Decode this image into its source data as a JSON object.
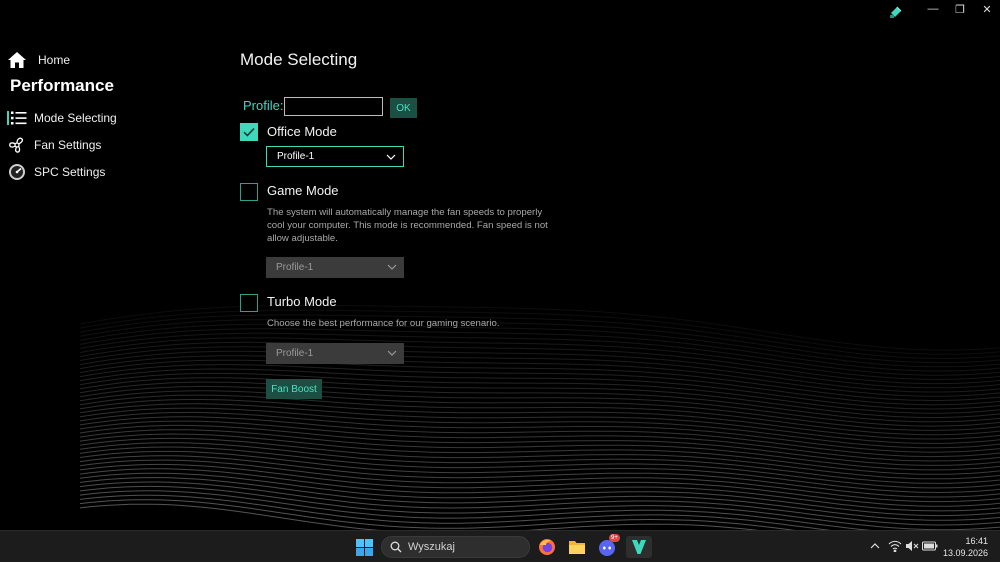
{
  "window": {
    "controls": {
      "minimize": "—",
      "maximize": "❐",
      "close": "✕"
    }
  },
  "sidebar": {
    "home_label": "Home",
    "section_title": "Performance",
    "items": [
      {
        "label": "Mode Selecting",
        "icon": "list-icon"
      },
      {
        "label": "Fan Settings",
        "icon": "fan-icon"
      },
      {
        "label": "SPC Settings",
        "icon": "speedometer-icon"
      }
    ]
  },
  "main": {
    "title": "Mode Selecting",
    "profile": {
      "label": "Profile:",
      "value": "",
      "ok_label": "OK"
    },
    "modes": [
      {
        "label": "Office Mode",
        "checked": true,
        "select_value": "Profile-1",
        "select_enabled": true,
        "description": ""
      },
      {
        "label": "Game Mode",
        "checked": false,
        "select_value": "Profile-1",
        "select_enabled": false,
        "description": "The system will automatically manage the fan speeds to properly cool your computer.  This mode is recommended. Fan speed is not allow adjustable."
      },
      {
        "label": "Turbo Mode",
        "checked": false,
        "select_value": "Profile-1",
        "select_enabled": false,
        "description": "Choose the best performance for our gaming scenario."
      }
    ],
    "fan_boost_label": "Fan Boost"
  },
  "taskbar": {
    "search_placeholder": "Wyszukaj",
    "discord_badge": "9+",
    "time": "16:41",
    "date": "13.09.2026"
  },
  "colors": {
    "accent": "#3fd8bd",
    "accent_dark": "#1c4f44",
    "background": "#000000",
    "taskbar": "#1c1c1c"
  }
}
